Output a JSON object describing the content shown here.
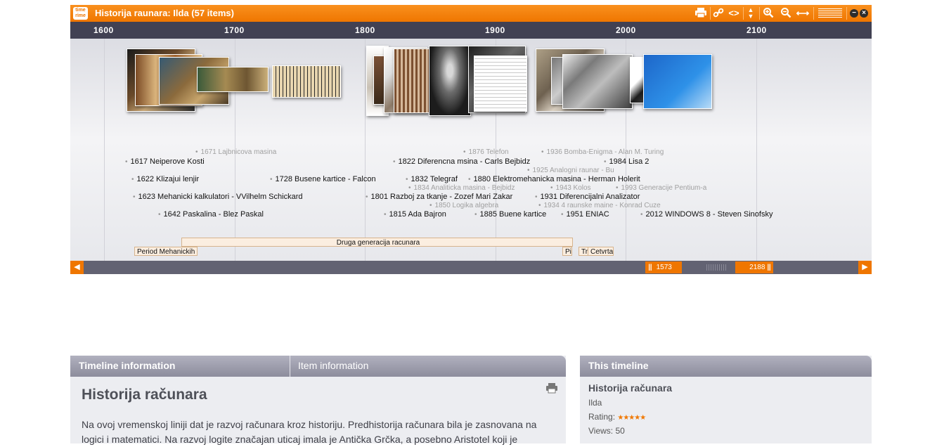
{
  "timeline": {
    "logo_text": "time rime",
    "title": "Historija raunara: Ilda  (57 items)",
    "toolbar": [
      "printer-icon",
      "link-icon",
      "code-icon",
      "updown-icon",
      "zoom-in-icon",
      "zoom-out-icon",
      "fit-width-icon",
      "menu-lines-icon",
      "minimize-icon",
      "close-icon"
    ],
    "years": [
      "1600",
      "1700",
      "1800",
      "1900",
      "2000",
      "2100"
    ],
    "events": [
      {
        "text": "1671 Lajbnicova masina",
        "faint": true
      },
      {
        "text": "1617 Neiperove Kosti"
      },
      {
        "text": "1622 Klizajui lenjir"
      },
      {
        "text": "1728 Busene kartice - Falcon"
      },
      {
        "text": "1623 Mehanicki kalkulatori - VVilhelm Schickard"
      },
      {
        "text": "1642 Paskalina - Blez Paskal"
      },
      {
        "text": "1876 Telefon",
        "faint": true
      },
      {
        "text": "1822 Diferencna msina - Carls Bejbidz"
      },
      {
        "text": "1832 Telegraf"
      },
      {
        "text": "1834 Analiticka masina - Bejbidz",
        "faint": true
      },
      {
        "text": "1801 Razboj za tkanje - Zozef Mari Zakar"
      },
      {
        "text": "1850 Logika algebra",
        "faint": true
      },
      {
        "text": "1815 Ada Bajron"
      },
      {
        "text": "1880 Elektromehanicka masina  - Herman Holerit"
      },
      {
        "text": "1885 Buene kartice"
      },
      {
        "text": "1936 Bomba-Enigma - Alan M. Turing",
        "faint": true
      },
      {
        "text": "1925 Analogni raunar - Bu",
        "faint": true
      },
      {
        "text": "1984 Lisa 2"
      },
      {
        "text": "1943 Kolos",
        "faint": true
      },
      {
        "text": "1993 Generacije Pentium-a",
        "faint": true
      },
      {
        "text": "1931 Diferencijalni Analizator"
      },
      {
        "text": "1934 4 raunske maine - Konrad Cuze",
        "faint": true
      },
      {
        "text": "1951 ENIAC"
      },
      {
        "text": "2012 WINDOWS 8 - Steven Sinofsky"
      }
    ],
    "periods": [
      {
        "label": "Druga generacija racunara"
      },
      {
        "label": "Period Mehanickih"
      },
      {
        "label": "Pi"
      },
      {
        "label": "Tr"
      },
      {
        "label": "Cetvrta"
      }
    ],
    "nav": {
      "range_start": "1573",
      "range_end": "2188"
    }
  },
  "info": {
    "tabs": [
      "Timeline information",
      "Item information"
    ],
    "active_tab": "Timeline information",
    "title": "Historija računara",
    "description": "Na ovoj vremenskoj liniji dat je razvoj računara kroz historiju. Predhistorija računara bila je zasnovana na logici i matematici. Na razvoj logite značajan uticaj imala je Antička Grčka, a posebno Aristotel koji je"
  },
  "side": {
    "header": "This timeline",
    "title": "Historija računara",
    "author": "Ilda",
    "rating_label": "Rating:",
    "rating_stars": "★★★★★",
    "rating_value": 5,
    "views": "Views: 50"
  },
  "colors": {
    "accent": "#ef7600",
    "scale": "#414153",
    "panel": "#ecedf1",
    "tabbar": "#9d9dab"
  }
}
